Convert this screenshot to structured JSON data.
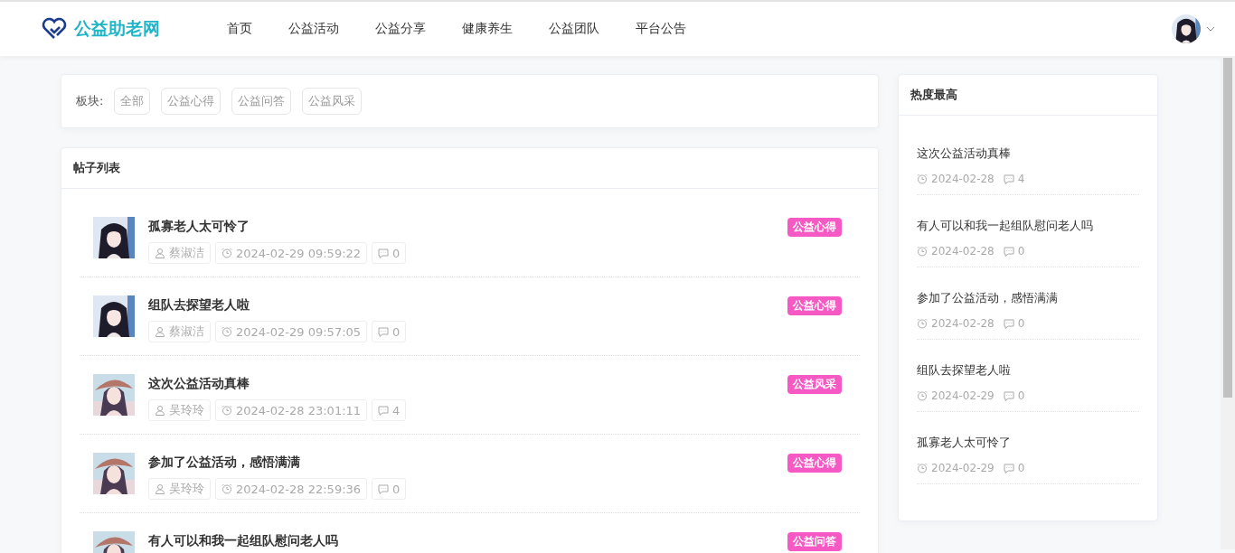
{
  "header": {
    "logo": "公益助老网",
    "nav": [
      {
        "label": "首页",
        "selected": false
      },
      {
        "label": "公益活动",
        "selected": false
      },
      {
        "label": "公益分享",
        "selected": false
      },
      {
        "label": "健康养生",
        "selected": false
      },
      {
        "label": "公益团队",
        "selected": false
      },
      {
        "label": "平台公告",
        "selected": false
      }
    ]
  },
  "filter": {
    "label": "板块:",
    "options": [
      {
        "label": "全部",
        "selected": false
      },
      {
        "label": "公益心得",
        "selected": false
      },
      {
        "label": "公益问答",
        "selected": false
      },
      {
        "label": "公益风采",
        "selected": false
      }
    ]
  },
  "posts": {
    "title": "帖子列表",
    "items": [
      {
        "title": "孤寡老人太可怜了",
        "author": "蔡淑洁",
        "time": "2024-02-29 09:59:22",
        "comments": "0",
        "tag": "公益心得"
      },
      {
        "title": "组队去探望老人啦",
        "author": "蔡淑洁",
        "time": "2024-02-29 09:57:05",
        "comments": "0",
        "tag": "公益心得"
      },
      {
        "title": "这次公益活动真棒",
        "author": "吴玲玲",
        "time": "2024-02-28 23:01:11",
        "comments": "4",
        "tag": "公益风采"
      },
      {
        "title": "参加了公益活动，感悟满满",
        "author": "吴玲玲",
        "time": "2024-02-28 22:59:36",
        "comments": "0",
        "tag": "公益心得"
      },
      {
        "title": "有人可以和我一起组队慰问老人吗",
        "tag": "公益问答"
      }
    ]
  },
  "hot": {
    "title": "热度最高",
    "items": [
      {
        "title": "这次公益活动真棒",
        "date": "2024-02-28",
        "comments": "4"
      },
      {
        "title": "有人可以和我一起组队慰问老人吗",
        "date": "2024-02-28",
        "comments": "0"
      },
      {
        "title": "参加了公益活动，感悟满满",
        "date": "2024-02-28",
        "comments": "0"
      },
      {
        "title": "组队去探望老人啦",
        "date": "2024-02-29",
        "comments": "0"
      },
      {
        "title": "孤寡老人太可怜了",
        "date": "2024-02-29",
        "comments": "0"
      }
    ]
  }
}
